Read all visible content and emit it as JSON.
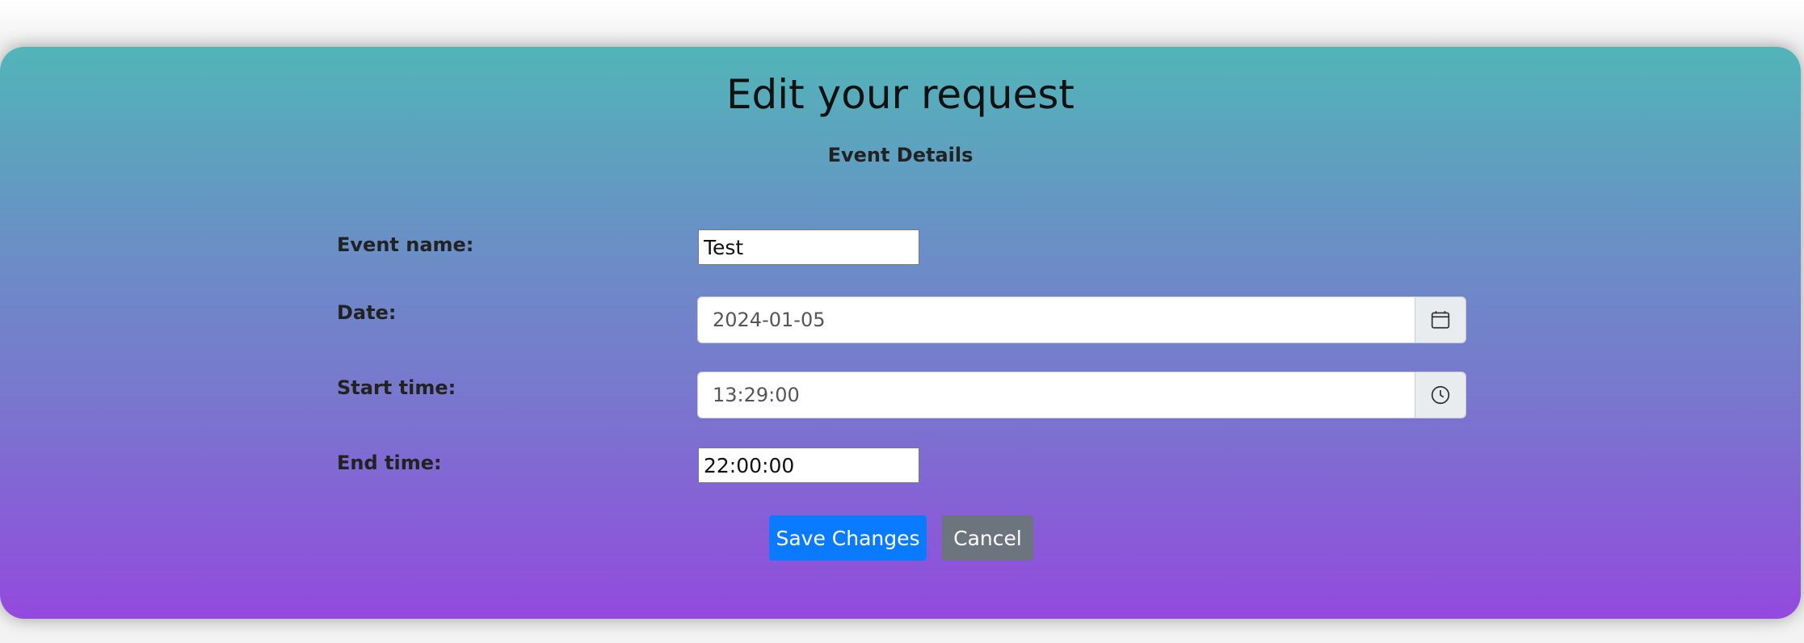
{
  "page": {
    "title": "Edit your request",
    "subtitle": "Event Details"
  },
  "form": {
    "event_name": {
      "label": "Event name:",
      "value": "Test"
    },
    "date": {
      "label": "Date:",
      "value": "2024-01-05",
      "icon": "calendar-icon"
    },
    "start_time": {
      "label": "Start time:",
      "value": "13:29:00",
      "icon": "clock-icon"
    },
    "end_time": {
      "label": "End time:",
      "value": "22:00:00"
    }
  },
  "actions": {
    "save_label": "Save Changes",
    "cancel_label": "Cancel"
  },
  "colors": {
    "gradient_top": "#51b5b8",
    "gradient_bottom": "#934ade",
    "save_button": "#0a7bff",
    "cancel_button": "#6c757d"
  }
}
